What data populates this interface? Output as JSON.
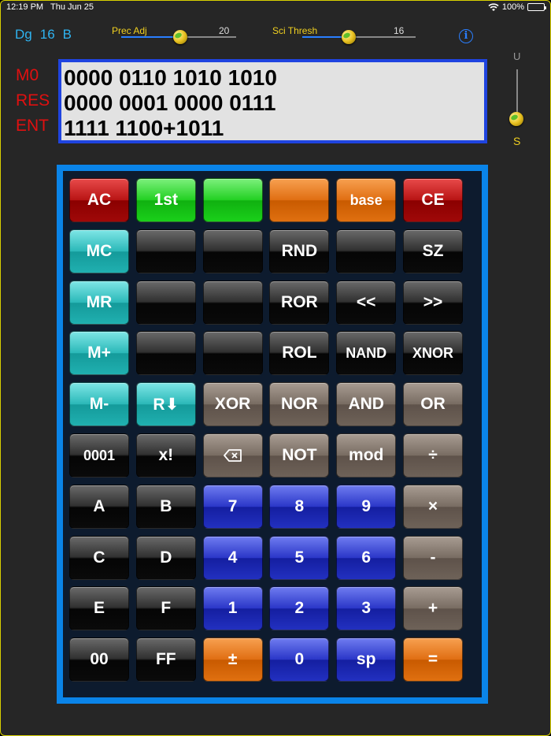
{
  "status": {
    "time": "12:19 PM",
    "date": "Thu Jun 25",
    "battery": "100%"
  },
  "mode": {
    "angle": "Dg",
    "digits": "16",
    "base": "B"
  },
  "prec_adj": {
    "label": "Prec Adj",
    "value": "20"
  },
  "sci_thresh": {
    "label": "Sci Thresh",
    "value": "16"
  },
  "info_icon": "i",
  "registers": [
    {
      "label": "M0",
      "value": "0000 0110 1010 1010"
    },
    {
      "label": "RES",
      "value": "0000 0001 0000 0111"
    },
    {
      "label": "ENT",
      "value": "1111 1100+1011"
    }
  ],
  "sign_mode": {
    "top": "U",
    "bottom": "S"
  },
  "keys": [
    [
      "AC",
      "1st",
      "",
      "",
      "base",
      "CE"
    ],
    [
      "MC",
      "",
      "",
      "RND",
      "",
      "SZ"
    ],
    [
      "MR",
      "",
      "",
      "ROR",
      "<<",
      ">>"
    ],
    [
      "M+",
      "",
      "",
      "ROL",
      "NAND",
      "XNOR"
    ],
    [
      "M-",
      "R⬇",
      "XOR",
      "NOR",
      "AND",
      "OR"
    ],
    [
      "0001",
      "x!",
      "backspace-icon",
      "NOT",
      "mod",
      "÷"
    ],
    [
      "A",
      "B",
      "7",
      "8",
      "9",
      "×"
    ],
    [
      "C",
      "D",
      "4",
      "5",
      "6",
      "-"
    ],
    [
      "E",
      "F",
      "1",
      "2",
      "3",
      "+"
    ],
    [
      "00",
      "FF",
      "±",
      "0",
      "sp",
      "="
    ]
  ],
  "colors": {
    "frame": "#d8d000",
    "display_border": "#1f44e0",
    "keypad_border": "#0a84e8",
    "register_label": "#e01010"
  }
}
